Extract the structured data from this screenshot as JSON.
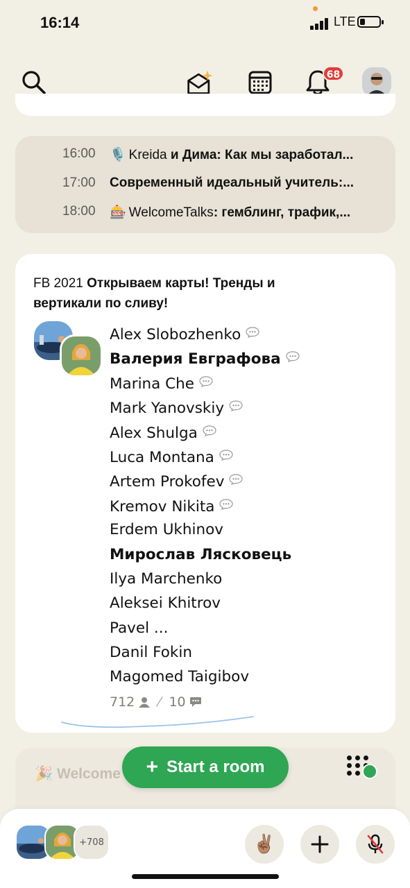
{
  "status": {
    "time": "16:14",
    "network": "LTE"
  },
  "topbar": {
    "notification_count": "68"
  },
  "schedule": [
    {
      "time": "16:00",
      "emoji": "🎙️",
      "lead": "Kreida",
      "rest": " и Дима: Как мы заработал..."
    },
    {
      "time": "17:00",
      "emoji": "",
      "lead": "",
      "rest": "Современный идеальный учитель:..."
    },
    {
      "time": "18:00",
      "emoji": "🎰",
      "lead": "WelcomeTalks",
      "rest": ": гемблинг, трафик,..."
    }
  ],
  "room": {
    "club": "FB 2021",
    "title": "Открываем карты! Тренды и вертикали по сливу!",
    "participants": [
      {
        "name": "Alex Slobozhenko",
        "bold": false,
        "speech": true
      },
      {
        "name": "Валерия Евграфова",
        "bold": true,
        "speech": true
      },
      {
        "name": "Marina Che",
        "bold": false,
        "speech": true
      },
      {
        "name": "Mark Yanovskiy",
        "bold": false,
        "speech": true
      },
      {
        "name": "Alex Shulga",
        "bold": false,
        "speech": true
      },
      {
        "name": "Luca Montana",
        "bold": false,
        "speech": true
      },
      {
        "name": "Artem Prokofev",
        "bold": false,
        "speech": true
      },
      {
        "name": "Kremov Nikita",
        "bold": false,
        "speech": true
      },
      {
        "name": "Erdem Ukhinov",
        "bold": false,
        "speech": false
      },
      {
        "name": "Мирослав Лясковець",
        "bold": true,
        "speech": false
      },
      {
        "name": "Ilya Marchenko",
        "bold": false,
        "speech": false
      },
      {
        "name": "Aleksei Khitrov",
        "bold": false,
        "speech": false
      },
      {
        "name": "Pavel ...",
        "bold": false,
        "speech": false
      },
      {
        "name": "Danil Fokin",
        "bold": false,
        "speech": false
      },
      {
        "name": "Magomed Taigibov",
        "bold": false,
        "speech": false
      }
    ],
    "listeners": "712",
    "speakers": "10"
  },
  "behind_card": {
    "title": "Welcome"
  },
  "actions": {
    "start_room": "Start a room"
  },
  "bottom": {
    "more_count": "+708",
    "raise_hand": "✌🏽"
  },
  "colors": {
    "background": "#f2efe4",
    "accent_green": "#2ea653",
    "badge_red": "#e23d3b",
    "schedule_bg": "#e7e2d5"
  }
}
